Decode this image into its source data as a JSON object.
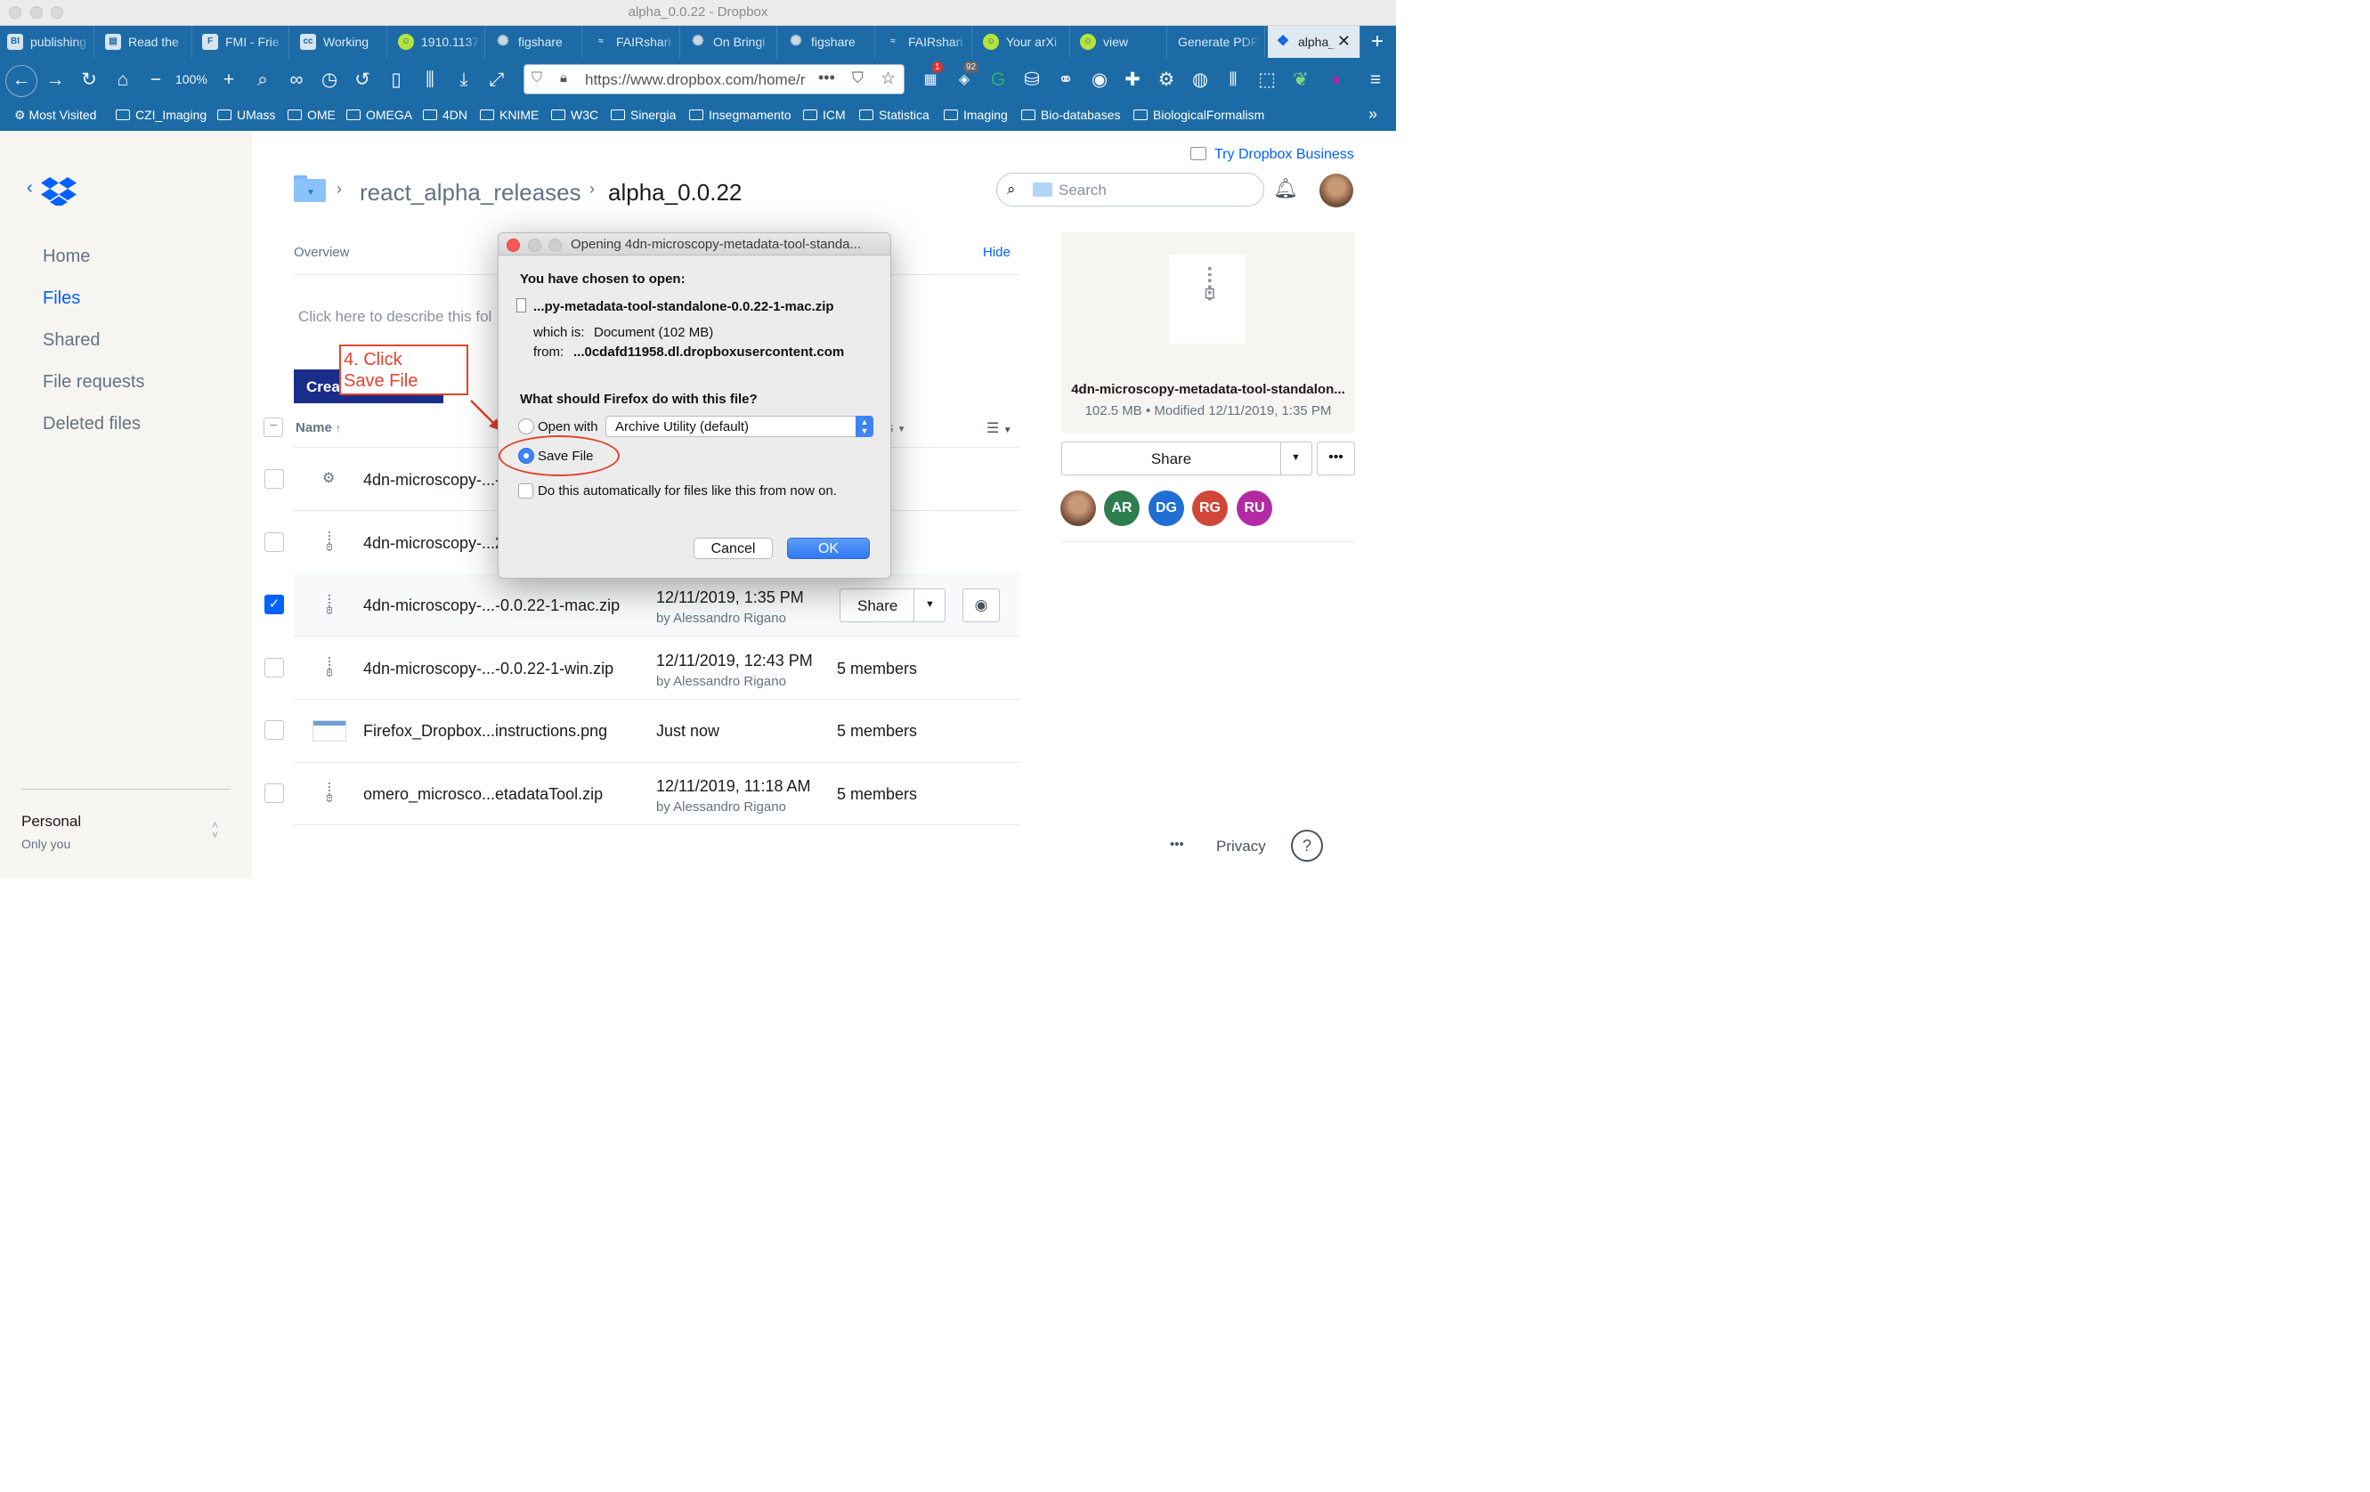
{
  "window": {
    "title": "alpha_0.0.22 - Dropbox"
  },
  "tabs": [
    {
      "label": "publishing",
      "icon": "bi-icon"
    },
    {
      "label": "Read the",
      "icon": "reader-icon"
    },
    {
      "label": "FMI - Frie",
      "icon": "fmi-icon"
    },
    {
      "label": "Working",
      "icon": "cc-icon"
    },
    {
      "label": "1910.1137",
      "icon": "smiley-icon"
    },
    {
      "label": "figshare",
      "icon": "figshare-icon"
    },
    {
      "label": "FAIRshari",
      "icon": "fairsharing-icon"
    },
    {
      "label": "On Bringi",
      "icon": "figshare-icon"
    },
    {
      "label": "figshare",
      "icon": "figshare-icon"
    },
    {
      "label": "FAIRshari",
      "icon": "fairsharing-icon"
    },
    {
      "label": "Your arXi",
      "icon": "smiley-icon"
    },
    {
      "label": "view",
      "icon": "smiley-icon"
    },
    {
      "label": "Generate PDF",
      "icon": ""
    },
    {
      "label": "alpha_",
      "icon": "dropbox-icon"
    }
  ],
  "navbar": {
    "zoom": "100%",
    "url": "https://www.dropbox.com/home/r",
    "badge_1": "1",
    "badge_2": "92"
  },
  "bookmarks": {
    "most_visited": "Most Visited",
    "folders": [
      "CZI_Imaging",
      "UMass",
      "OME",
      "OMEGA",
      "4DN",
      "KNIME",
      "W3C",
      "Sinergia",
      "Insegmamento",
      "ICM",
      "Statistica",
      "Imaging",
      "Bio-databases",
      "BiologicalFormalism"
    ]
  },
  "sidebar": {
    "items": [
      "Home",
      "Files",
      "Shared",
      "File requests",
      "Deleted files"
    ],
    "account_name": "Personal",
    "account_sub": "Only you"
  },
  "header": {
    "try_business": "Try Dropbox Business",
    "breadcrumb_parent": "react_alpha_releases",
    "breadcrumb_current": "alpha_0.0.22",
    "search_placeholder": "Search"
  },
  "overview": {
    "label": "Overview",
    "hide": "Hide",
    "describe_placeholder": "Click here to describe this fol",
    "create_button": "Crea"
  },
  "annotation": {
    "line1": "4. Click",
    "line2": "Save File"
  },
  "table": {
    "name_header": "Name",
    "rows": [
      {
        "name": "4dn-microscopy-...-",
        "date": "",
        "by": "",
        "members": "bers",
        "checked": false,
        "icon": "gear-icon"
      },
      {
        "name": "4dn-microscopy-...2",
        "date": "",
        "by": "",
        "members": "bers",
        "checked": false,
        "icon": "zip-icon"
      },
      {
        "name": "4dn-microscopy-...-0.0.22-1-mac.zip",
        "date": "12/11/2019, 1:35 PM",
        "by": "by Alessandro Rigano",
        "members": "",
        "checked": true,
        "icon": "zip-icon"
      },
      {
        "name": "4dn-microscopy-...-0.0.22-1-win.zip",
        "date": "12/11/2019, 12:43 PM",
        "by": "by Alessandro Rigano",
        "members": "5 members",
        "checked": false,
        "icon": "zip-icon"
      },
      {
        "name": "Firefox_Dropbox...instructions.png",
        "date": "Just now",
        "by": "",
        "members": "5 members",
        "checked": false,
        "icon": "image-thumbnail"
      },
      {
        "name": "omero_microsco...etadataTool.zip",
        "date": "12/11/2019, 11:18 AM",
        "by": "by Alessandro Rigano",
        "members": "5 members",
        "checked": false,
        "icon": "zip-icon"
      }
    ],
    "row_share": "Share",
    "header_sort_fragment": "s"
  },
  "preview": {
    "filename": "4dn-microscopy-metadata-tool-standalon...",
    "meta": "102.5 MB • Modified 12/11/2019, 1:35 PM",
    "share": "Share",
    "avatars": [
      {
        "initials": "",
        "color": "#b9875e"
      },
      {
        "initials": "AR",
        "color": "#2e7d4f"
      },
      {
        "initials": "DG",
        "color": "#1f6ed4"
      },
      {
        "initials": "RG",
        "color": "#d0473a"
      },
      {
        "initials": "RU",
        "color": "#b32ba3"
      }
    ]
  },
  "footer": {
    "privacy": "Privacy",
    "help": "?"
  },
  "dialog": {
    "title": "Opening 4dn-microscopy-metadata-tool-standa...",
    "chosen": "You have chosen to open:",
    "filename": "...py-metadata-tool-standalone-0.0.22-1-mac.zip",
    "which_is_label": "which is:",
    "which_is_value": "Document (102 MB)",
    "from_label": "from:",
    "from_value": "...0cdafd11958.dl.dropboxusercontent.com",
    "question": "What should Firefox do with this file?",
    "open_with": "Open with",
    "open_with_app": "Archive Utility (default)",
    "save_file": "Save File",
    "auto": "Do this automatically for files like this from now on.",
    "cancel": "Cancel",
    "ok": "OK"
  },
  "colors": {
    "tabbar": "#1c6ba6",
    "dropbox_blue": "#0061fe",
    "link": "#0d64e7",
    "annotation_red": "#e0442e"
  }
}
